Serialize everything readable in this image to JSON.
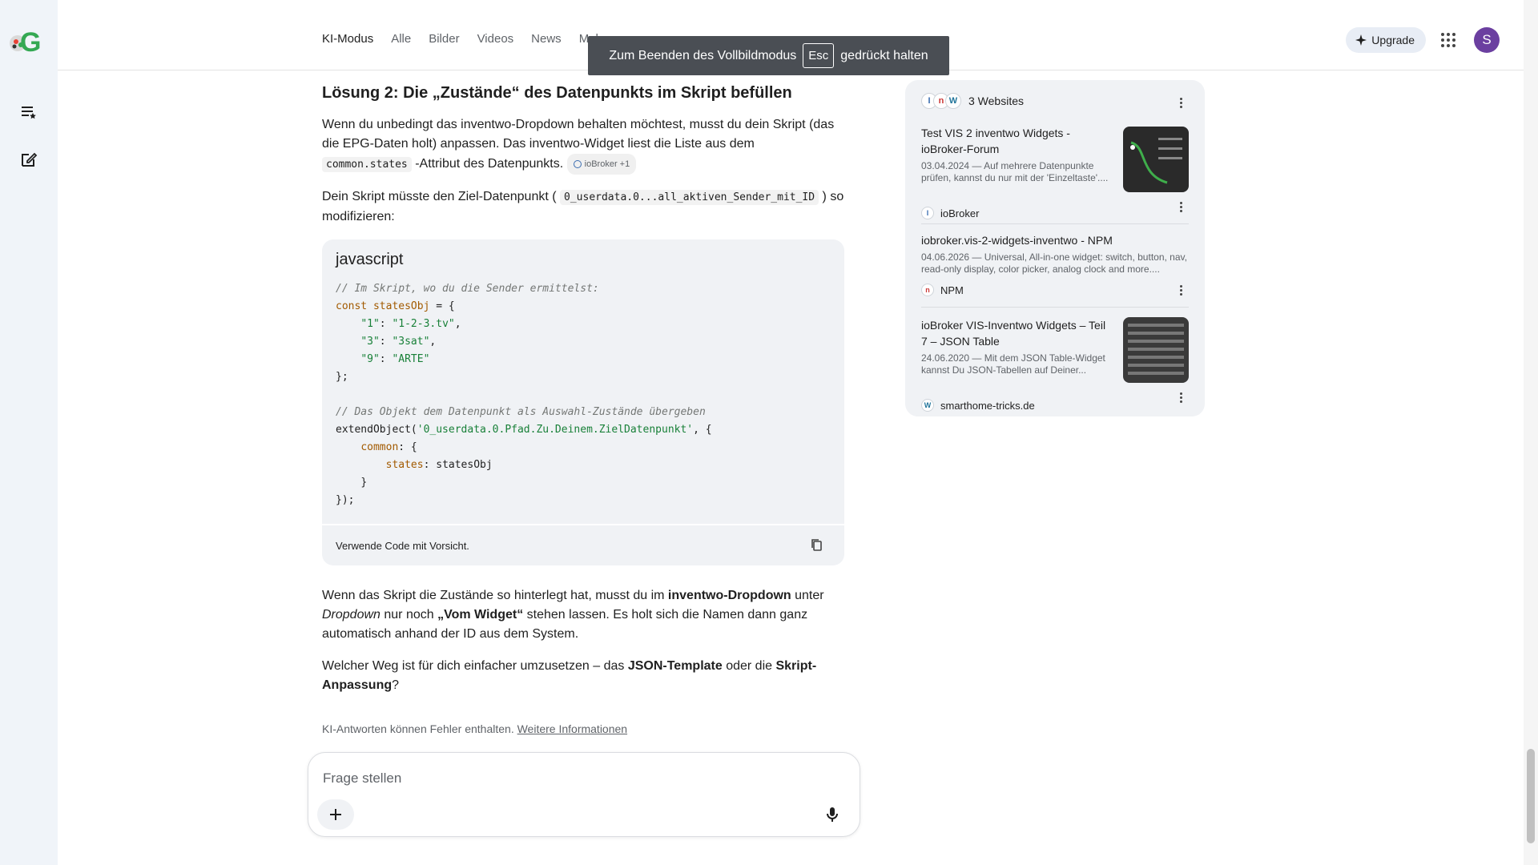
{
  "header": {
    "tabs": [
      "KI-Modus",
      "Alle",
      "Bilder",
      "Videos",
      "News",
      "Mehr"
    ],
    "upgrade_label": "Upgrade",
    "avatar_letter": "S"
  },
  "toast": {
    "pre": "Zum Beenden des Vollbildmodus",
    "key": "Esc",
    "post": "gedrückt halten"
  },
  "main": {
    "heading": "Lösung 2: Die „Zustände“ des Datenpunkts im Skript befüllen",
    "p1_a": "Wenn du unbedingt das inventwo-Dropdown behalten möchtest, musst du dein Skript (das die EPG-Daten holt) anpassen. Das inventwo-Widget liest die Liste aus dem ",
    "p1_code": "common.states",
    "p1_b": " -Attribut des Datenpunkts.",
    "p1_chip": "ioBroker +1",
    "p2_a": "Dein Skript müsste den Ziel-Datenpunkt ( ",
    "p2_code": "0_userdata.0...all_aktiven_Sender_mit_ID",
    "p2_b": " ) so modifizieren:",
    "code_lang": "javascript",
    "code_footer": "Verwende Code mit Vorsicht.",
    "p3_a": "Wenn das Skript die Zustände so hinterlegt hat, musst du im ",
    "p3_b1": "inventwo-Dropdown",
    "p3_c": " unter ",
    "p3_i": "Dropdown",
    "p3_d": " nur noch ",
    "p3_b2": "„Vom Widget“",
    "p3_e": " stehen lassen. Es holt sich die Namen dann ganz automatisch anhand der ID aus dem System.",
    "p4_a": "Welcher Weg ist für dich einfacher umzusetzen – das ",
    "p4_b1": "JSON-Template",
    "p4_c": " oder die ",
    "p4_b2": "Skript-Anpassung",
    "p4_d": "?",
    "disclaimer": "KI-Antworten können Fehler enthalten.",
    "disclaimer_link": "Weitere Informationen"
  },
  "code_lines": {
    "l1": "// Im Skript, wo du die Sender ermittelst:",
    "l2_kw": "const",
    "l2_var": "statesObj",
    "l2_rest": " = {",
    "l3_k": "\"1\"",
    "l3_v": "\"1-2-3.tv\"",
    "l4_k": "\"3\"",
    "l4_v": "\"3sat\"",
    "l5_k": "\"9\"",
    "l5_v": "\"ARTE\"",
    "l6": "};",
    "l8": "// Das Objekt dem Datenpunkt als Auswahl-Zustände übergeben",
    "l9_fn": "extendObject(",
    "l9_str": "'0_userdata.0.Pfad.Zu.Deinem.ZielDatenpunkt'",
    "l9_rest": ", {",
    "l10_p": "common",
    "l10_rest": ": {",
    "l11_p": "states",
    "l11_rest": ": statesObj",
    "l12": "}",
    "l13": "});"
  },
  "ask": {
    "placeholder": "Frage stellen"
  },
  "sources": {
    "count_label": "3 Websites",
    "items": [
      {
        "title": "Test VIS 2 inventwo Widgets - ioBroker-Forum",
        "snippet": "03.04.2024 — Auf mehrere Datenpunkte prüfen, kannst du nur mit der 'Einzeltaste'....",
        "site": "ioBroker"
      },
      {
        "title": "iobroker.vis-2-widgets-inventwo - NPM",
        "snippet": "04.06.2026 — Universal, All-in-one widget: switch, button, nav, read-only display, color picker, analog clock and more....",
        "site": "NPM"
      },
      {
        "title": "ioBroker VIS-Inventwo Widgets – Teil 7 – JSON Table",
        "snippet": "24.06.2020 — Mit dem JSON Table-Widget kannst Du JSON-Tabellen auf Deiner...",
        "site": "smarthome-tricks.de"
      }
    ]
  },
  "colors": {
    "accent": "#1a73e8",
    "avatar": "#6b3fa0",
    "rail_bg": "#f0f4f9",
    "code_bg": "#f0f2f5"
  }
}
